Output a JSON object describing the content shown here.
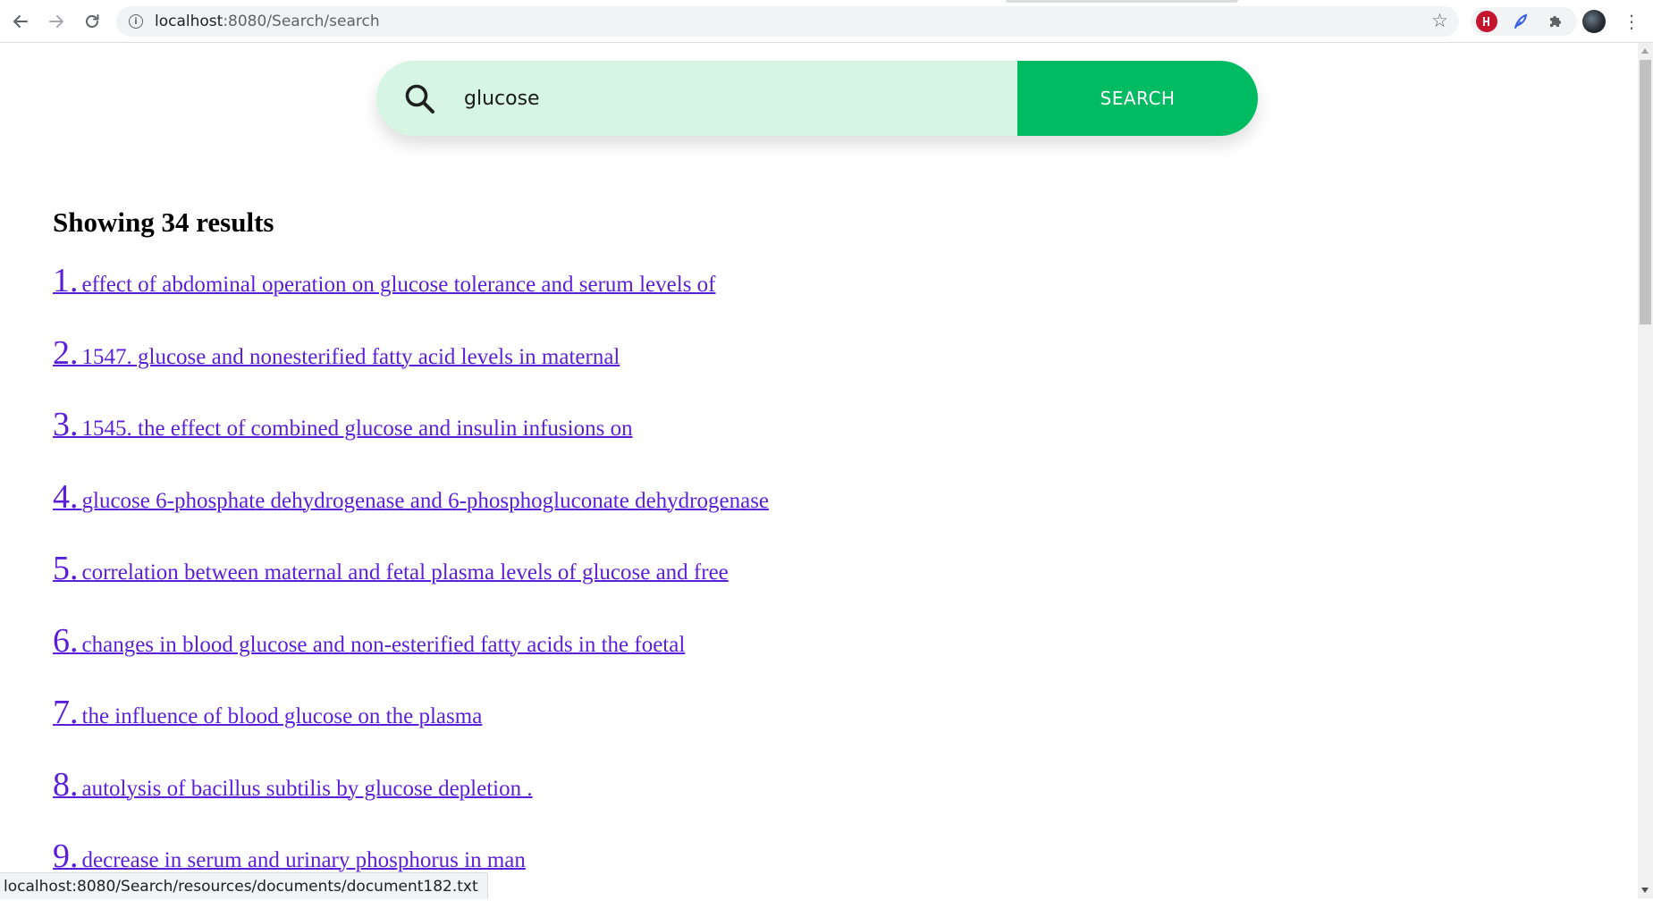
{
  "browser": {
    "url_host": "localhost",
    "url_path": ":8080/Search/search",
    "status_url": "localhost:8080/Search/resources/documents/document182.txt",
    "icons": {
      "back": "arrow-left-icon",
      "forward": "arrow-right-icon",
      "reload": "reload-icon",
      "info": "info-icon",
      "bookmark": "star-icon",
      "extensions": [
        "red-circle-extension-icon",
        "feather-extension-icon",
        "puzzle-extensions-icon"
      ],
      "menu": "vertical-dots-menu-icon"
    }
  },
  "search": {
    "value": "glucose",
    "button_label": "SEARCH",
    "colors": {
      "bar_bg": "#d6f5e4",
      "button_bg": "#00bb61",
      "button_text": "#ffffff"
    }
  },
  "results": {
    "heading": "Showing 34 results",
    "link_color": "#5b1fd9",
    "items": [
      {
        "num": "1.",
        "title": "effect of abdominal operation on glucose tolerance and serum levels of"
      },
      {
        "num": "2.",
        "title": "1547. glucose and nonesterified fatty acid levels in maternal"
      },
      {
        "num": "3.",
        "title": "1545. the effect of combined glucose and insulin infusions on"
      },
      {
        "num": "4.",
        "title": "glucose 6-phosphate dehydrogenase and 6-phosphogluconate dehydrogenase"
      },
      {
        "num": "5.",
        "title": "correlation between maternal and fetal plasma levels of glucose and free"
      },
      {
        "num": "6.",
        "title": "changes in blood glucose and non-esterified fatty acids in the foetal"
      },
      {
        "num": "7.",
        "title": "the influence of blood glucose on the plasma"
      },
      {
        "num": "8.",
        "title": "autolysis of bacillus subtilis by glucose depletion ."
      },
      {
        "num": "9.",
        "title": "decrease in serum and urinary phosphorus in man"
      }
    ]
  }
}
